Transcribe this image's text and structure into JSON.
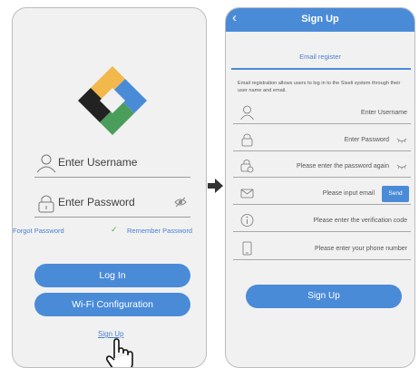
{
  "login": {
    "username_placeholder": "Enter Username",
    "password_placeholder": "Enter Password",
    "forgot_password": "Forgot Password",
    "remember_password": "Remember Password",
    "login_button": "Log In",
    "wifi_button": "Wi-Fi Configuration",
    "sign_up_link": "Sign Up"
  },
  "signup": {
    "title": "Sign Up",
    "tab": "Email register",
    "description": "Email registration allows users to log in to the Siseli system through their user name and email.",
    "username_placeholder": "Enter Username",
    "password_placeholder": "Enter Password",
    "confirm_password_placeholder": "Please enter the password again",
    "email_placeholder": "Please input email",
    "send_button": "Send",
    "code_placeholder": "Please enter the verification code",
    "phone_placeholder": "Please enter your phone number",
    "submit_button": "Sign Up"
  },
  "colors": {
    "accent": "#4a8bd8",
    "link": "#4a7fd0",
    "check": "#52b44a"
  }
}
